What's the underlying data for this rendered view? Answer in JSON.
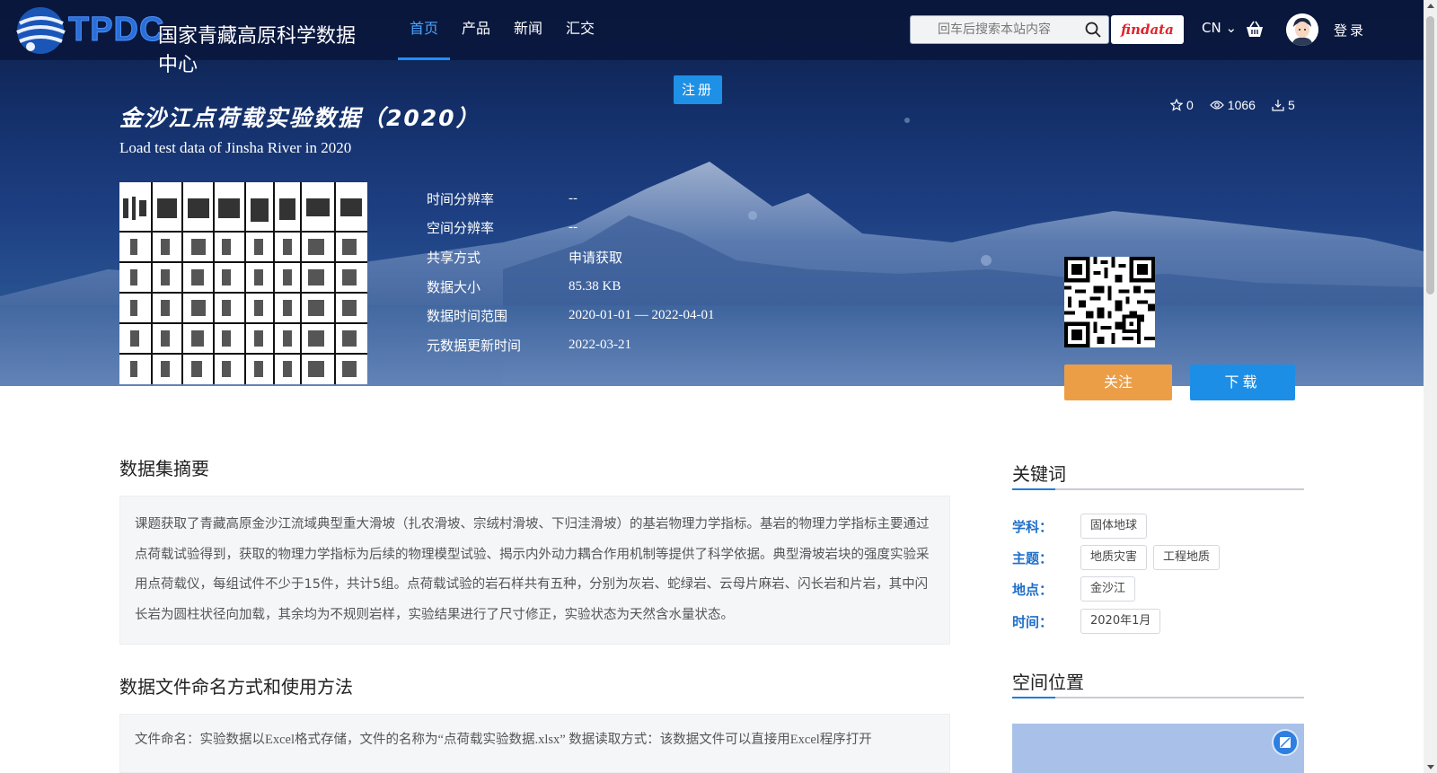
{
  "header": {
    "logo_text": "TPDC",
    "site_name": "国家青藏高原科学数据中心",
    "nav": [
      {
        "label": "首页",
        "active": true
      },
      {
        "label": "产品",
        "active": false
      },
      {
        "label": "新闻",
        "active": false
      },
      {
        "label": "汇交",
        "active": false
      }
    ],
    "search": {
      "placeholder": "回车后搜索本站内容",
      "value": ""
    },
    "findata_label": "findata",
    "language": "CN",
    "login_label": "登录"
  },
  "register_label": "注册",
  "dataset": {
    "title": "金沙江点荷载实验数据（2020）",
    "title_en": "Load test data of Jinsha River in 2020",
    "stats": {
      "stars": "0",
      "views": "1066",
      "downloads": "5"
    },
    "meta": [
      {
        "key": "时间分辨率",
        "value": "--"
      },
      {
        "key": "空间分辨率",
        "value": "--"
      },
      {
        "key": "共享方式",
        "value": "申请获取"
      },
      {
        "key": "数据大小",
        "value": "85.38 KB"
      },
      {
        "key": "数据时间范围",
        "value": "2020-01-01 — 2022-04-01"
      },
      {
        "key": "元数据更新时间",
        "value": "2022-03-21"
      }
    ],
    "follow_label": "关注",
    "download_label": "下载"
  },
  "abstract": {
    "title": "数据集摘要",
    "text": "课题获取了青藏高原金沙江流域典型重大滑坡（扎农滑坡、宗绒村滑坡、下归洼滑坡）的基岩物理力学指标。基岩的物理力学指标主要通过点荷载试验得到，获取的物理力学指标为后续的物理模型试验、揭示内外动力耦合作用机制等提供了科学依据。典型滑坡岩块的强度实验采用点荷载仪，每组试件不少于15件，共计5组。点荷载试验的岩石样共有五种，分别为灰岩、蛇绿岩、云母片麻岩、闪长岩和片岩，其中闪长岩为圆柱状径向加载，其余均为不规则岩样，实验结果进行了尺寸修正，实验状态为天然含水量状态。"
  },
  "usage": {
    "title": "数据文件命名方式和使用方法",
    "text": "文件命名：实验数据以Excel格式存储，文件的名称为“点荷载实验数据.xlsx” 数据读取方式：该数据文件可以直接用Excel程序打开"
  },
  "keywords": {
    "title": "关键词",
    "rows": [
      {
        "label": "学科：",
        "tags": [
          "固体地球"
        ]
      },
      {
        "label": "主题：",
        "tags": [
          "地质灾害",
          "工程地质"
        ]
      },
      {
        "label": "地点：",
        "tags": [
          "金沙江"
        ]
      },
      {
        "label": "时间：",
        "tags": [
          "2020年1月"
        ]
      }
    ]
  },
  "spatial": {
    "title": "空间位置"
  },
  "colors": {
    "accent": "#1d8ee6",
    "follow": "#ec9e47",
    "keyword_label": "#1f6fc9"
  }
}
